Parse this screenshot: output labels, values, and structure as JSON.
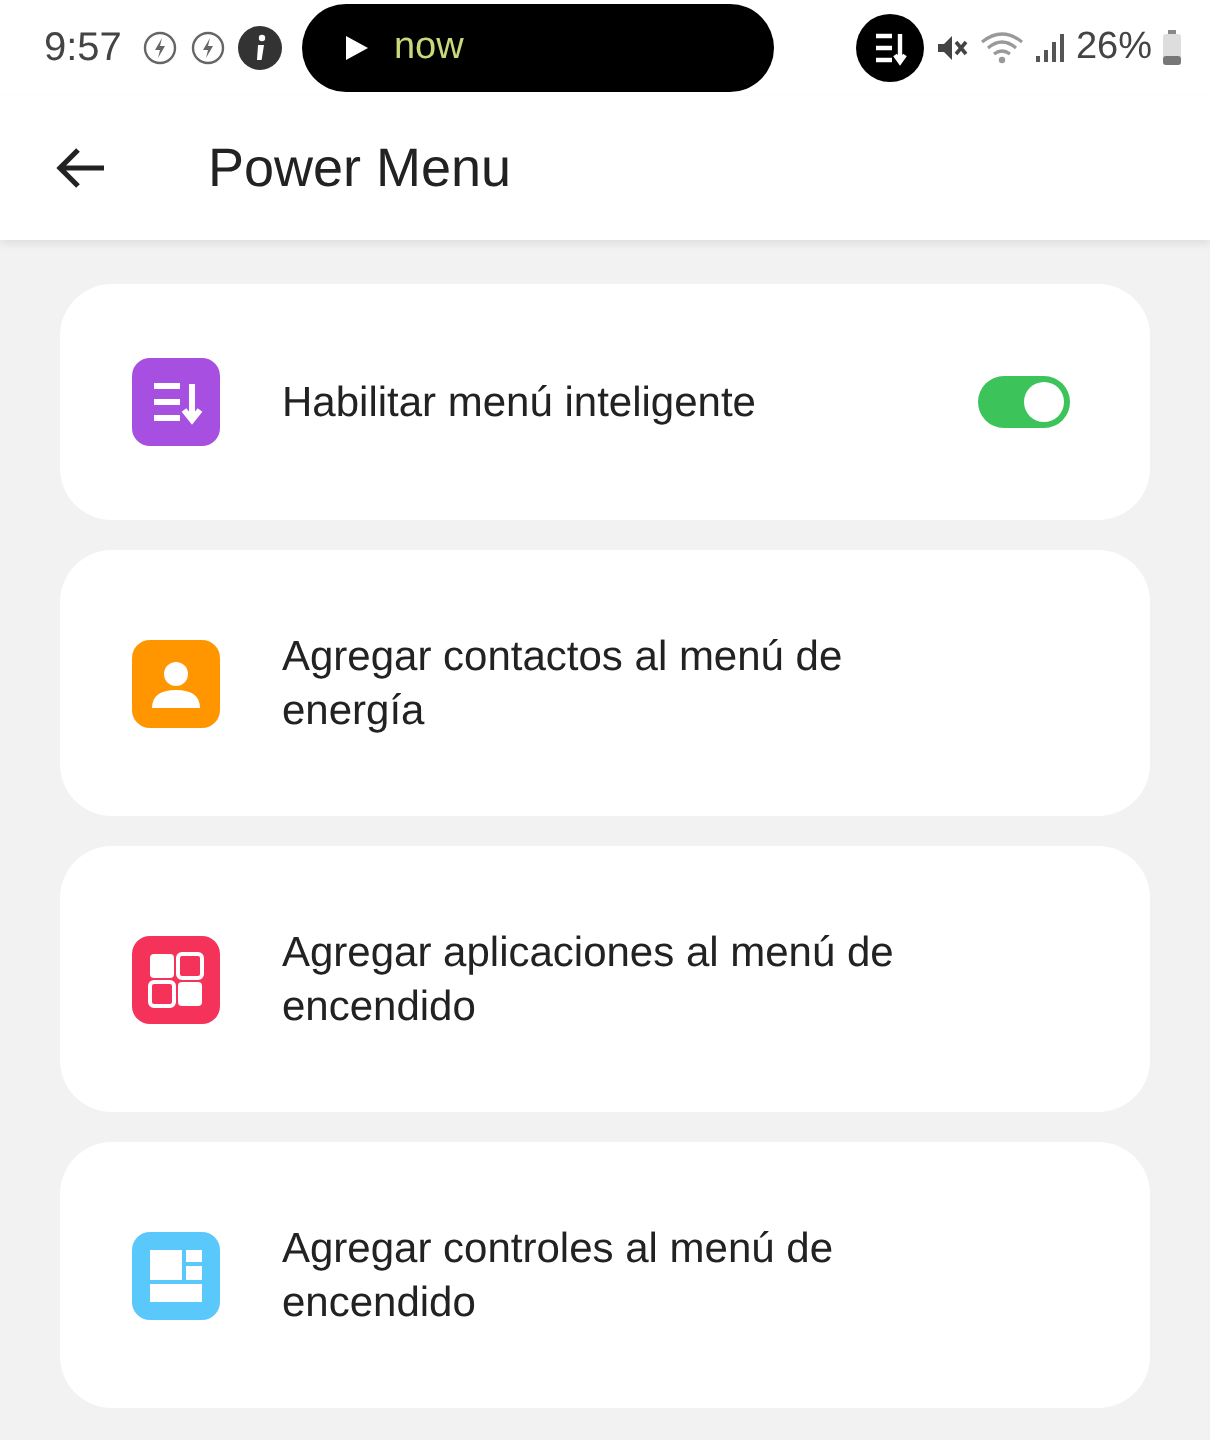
{
  "status_bar": {
    "time": "9:57",
    "media": "now",
    "battery": "26%"
  },
  "header": {
    "title": "Power Menu"
  },
  "items": [
    {
      "kind": "toggle",
      "label": "Habilitar menú inteligente",
      "color": "#a64fe0",
      "on": true
    },
    {
      "kind": "link",
      "label": "Agregar contactos al menú de energía",
      "color": "#ff9600"
    },
    {
      "kind": "link",
      "label": "Agregar aplicaciones al menú de encendido",
      "color": "#f4325a"
    },
    {
      "kind": "link",
      "label": "Agregar controles al menú de encendido",
      "color": "#5ac8fa"
    }
  ]
}
